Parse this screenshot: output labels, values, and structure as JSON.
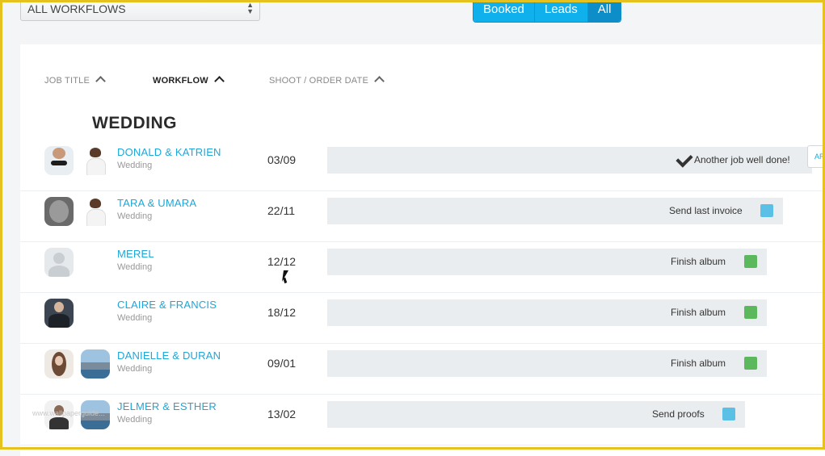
{
  "filter": {
    "selected": "ALL WORKFLOWS"
  },
  "segment": {
    "options": [
      "Booked",
      "Leads",
      "All"
    ],
    "active": "All"
  },
  "columns": {
    "job_title": "JOB TITLE",
    "workflow": "WORKFLOW",
    "shoot_date": "SHOOT / ORDER DATE"
  },
  "group": {
    "title": "WEDDING"
  },
  "rows": [
    {
      "name": "DONALD & KATRIEN",
      "type": "Wedding",
      "date": "03/09",
      "status": "Another job well done!",
      "status_color": "",
      "progress": 1.0,
      "done": true,
      "archive_label": "AR"
    },
    {
      "name": "TARA & UMARA",
      "type": "Wedding",
      "date": "22/11",
      "status": "Send last invoice",
      "status_color": "#5bc0e6",
      "progress": 0.92
    },
    {
      "name": "MEREL",
      "type": "Wedding",
      "date": "12/12",
      "status": "Finish album",
      "status_color": "#5cb85c",
      "progress": 0.88
    },
    {
      "name": "CLAIRE & FRANCIS",
      "type": "Wedding",
      "date": "18/12",
      "status": "Finish album",
      "status_color": "#5cb85c",
      "progress": 0.88
    },
    {
      "name": "DANIELLE & DURAN",
      "type": "Wedding",
      "date": "09/01",
      "status": "Finish album",
      "status_color": "#5cb85c",
      "progress": 0.88
    },
    {
      "name": "JELMER & ESTHER",
      "type": "Wedding",
      "date": "13/02",
      "status": "Send proofs",
      "status_color": "#5bc0e6",
      "progress": 0.83
    }
  ],
  "watermark": "www.wallpaperguide..."
}
